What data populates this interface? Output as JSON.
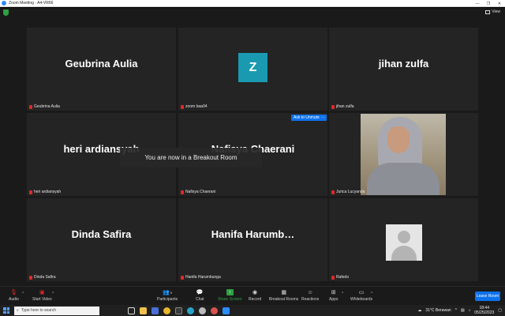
{
  "window": {
    "title": "Zoom Meeting - A4-VR66",
    "min": "—",
    "max": "❐",
    "close": "✕"
  },
  "topbar": {
    "view_label": "View"
  },
  "tiles": [
    {
      "big_name": "Geubrina Aulia",
      "label": "Geubrina Aulia"
    },
    {
      "initial": "Z",
      "label": "zoom baa04"
    },
    {
      "big_name": "jihan zulfa",
      "label": "jihan zulfa"
    },
    {
      "big_name": "heri ardiansyah",
      "label": "heri ardiansyah"
    },
    {
      "big_name": "Nafisya Chaerani",
      "label": "Nafisya Chaerani"
    },
    {
      "label": "Jurica Lucyanda"
    },
    {
      "big_name": "Dinda Safira",
      "label": "Dinda Safira"
    },
    {
      "big_name": "Hanifa  Harumb…",
      "label": "Hanifa Harumbunga"
    },
    {
      "label": "Rafedo"
    }
  ],
  "ask_to_unmute": "Ask to Unmute",
  "more_dots": "···",
  "breakout_message": "You are now in a Breakout Room",
  "toolbar": {
    "audio": "Audio",
    "start_video": "Start Video",
    "participants": "Participants",
    "participants_count": "9",
    "chat": "Chat",
    "share_screen": "Share Screen",
    "record": "Record",
    "breakout_rooms": "Breakout Rooms",
    "reactions": "Reactions",
    "apps": "Apps",
    "whiteboards": "Whiteboards",
    "leave": "Leave Room"
  },
  "taskbar": {
    "search_placeholder": "Type here to search",
    "weather": "31°C  Berawan",
    "time": "18:44",
    "date": "05/25/2023"
  },
  "colors": {
    "accent": "#0e71eb",
    "share_green": "#2ea043",
    "mute_red": "#e02828",
    "avatar_teal": "#1a9ab0"
  }
}
